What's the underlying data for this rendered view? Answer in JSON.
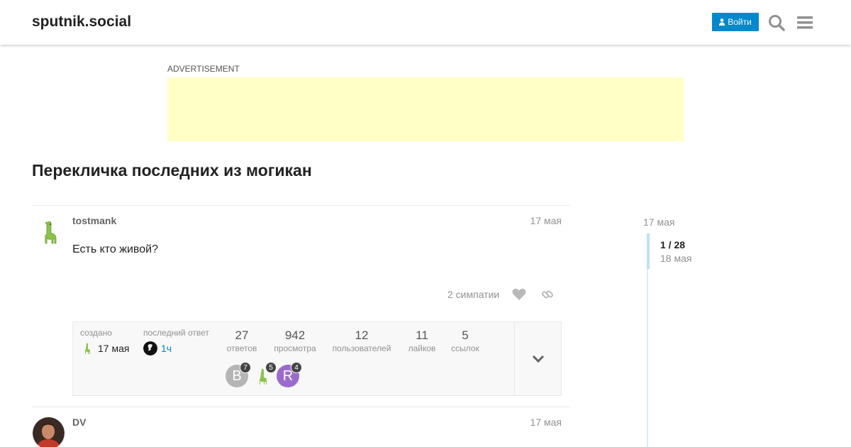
{
  "header": {
    "site_title": "sputnik.social",
    "login_label": "Войти"
  },
  "ad": {
    "label": "ADVERTISEMENT"
  },
  "topic": {
    "title": "Перекличка последних из могикан"
  },
  "posts": [
    {
      "username": "tostmank",
      "date": "17 мая",
      "body": "Есть кто живой?",
      "likes_text": "2 симпатии"
    },
    {
      "username": "DV",
      "date": "17 мая"
    }
  ],
  "topic_map": {
    "created_label": "создано",
    "created_value": "17 мая",
    "last_reply_label": "последний ответ",
    "last_reply_value": "1ч",
    "stats": [
      {
        "num": "27",
        "label": "ответов"
      },
      {
        "num": "942",
        "label": "просмотра"
      },
      {
        "num": "12",
        "label": "пользователей"
      },
      {
        "num": "11",
        "label": "лайков"
      },
      {
        "num": "5",
        "label": "ссылок"
      }
    ],
    "participants": [
      {
        "initial": "B",
        "count": "7",
        "color": "#b5b5b5"
      },
      {
        "initial": "",
        "count": "5",
        "color": "#ffffff"
      },
      {
        "initial": "R",
        "count": "4",
        "color": "#9b6bcc"
      }
    ]
  },
  "timeline": {
    "top_date": "17 мая",
    "position": "1 / 28",
    "bottom_date": "18 мая"
  },
  "colors": {
    "accent": "#0088cc",
    "ad_background": "#ffffc6"
  }
}
